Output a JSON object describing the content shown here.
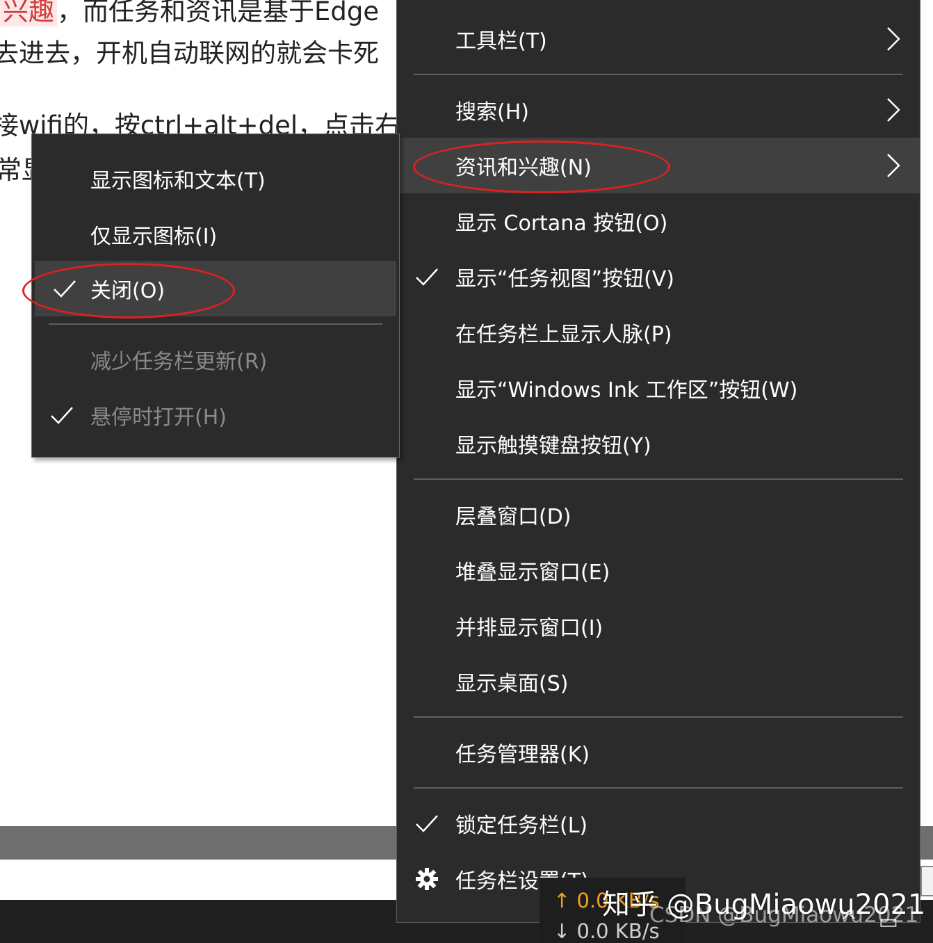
{
  "article": {
    "lines": [
      {
        "pre": "",
        "highlight": "兴趣",
        "post": "，而任务和资讯是基于Edge"
      },
      {
        "pre": "去进去，开机自动联网的就会卡死",
        "highlight": "",
        "post": ""
      },
      {
        "pre": "接wifi的，按ctrl+alt+del，点击右下",
        "highlight": "",
        "post": ""
      },
      {
        "pre": "常显",
        "highlight": "",
        "post": ""
      }
    ]
  },
  "main_menu": {
    "items": [
      {
        "label": "工具栏(T)",
        "has_submenu": true
      },
      {
        "label": "搜索(H)",
        "has_submenu": true
      },
      {
        "label": "资讯和兴趣(N)",
        "has_submenu": true
      },
      {
        "label": "显示 Cortana 按钮(O)"
      },
      {
        "label": "显示“任务视图”按钮(V)",
        "checked": true
      },
      {
        "label": "在任务栏上显示人脉(P)"
      },
      {
        "label": "显示“Windows Ink 工作区”按钮(W)"
      },
      {
        "label": "显示触摸键盘按钮(Y)"
      },
      {
        "label": "层叠窗口(D)"
      },
      {
        "label": "堆叠显示窗口(E)"
      },
      {
        "label": "并排显示窗口(I)"
      },
      {
        "label": "显示桌面(S)"
      },
      {
        "label": "任务管理器(K)"
      },
      {
        "label": "锁定任务栏(L)",
        "checked": true
      },
      {
        "label": "任务栏设置(T)",
        "icon": "gear-icon"
      }
    ]
  },
  "sub_menu": {
    "items": [
      {
        "label": "显示图标和文本(T)"
      },
      {
        "label": "仅显示图标(I)"
      },
      {
        "label": "关闭(O)",
        "checked": true
      },
      {
        "label": "减少任务栏更新(R)",
        "disabled": true
      },
      {
        "label": "悬停时打开(H)",
        "checked": true,
        "disabled": true
      }
    ]
  },
  "network": {
    "upload": "↑ 0.0 KB/s",
    "download": "↓ 0.0 KB/s"
  },
  "watermarks": {
    "zhihu": "知乎 @BugMiaowu2021",
    "csdn": "CSDN @BugMiaowu2021"
  },
  "colors": {
    "menu_bg": "#2b2b2b",
    "hover_bg": "#404040",
    "annotation_red": "#e02020",
    "upload_speed": "#f0a020"
  }
}
